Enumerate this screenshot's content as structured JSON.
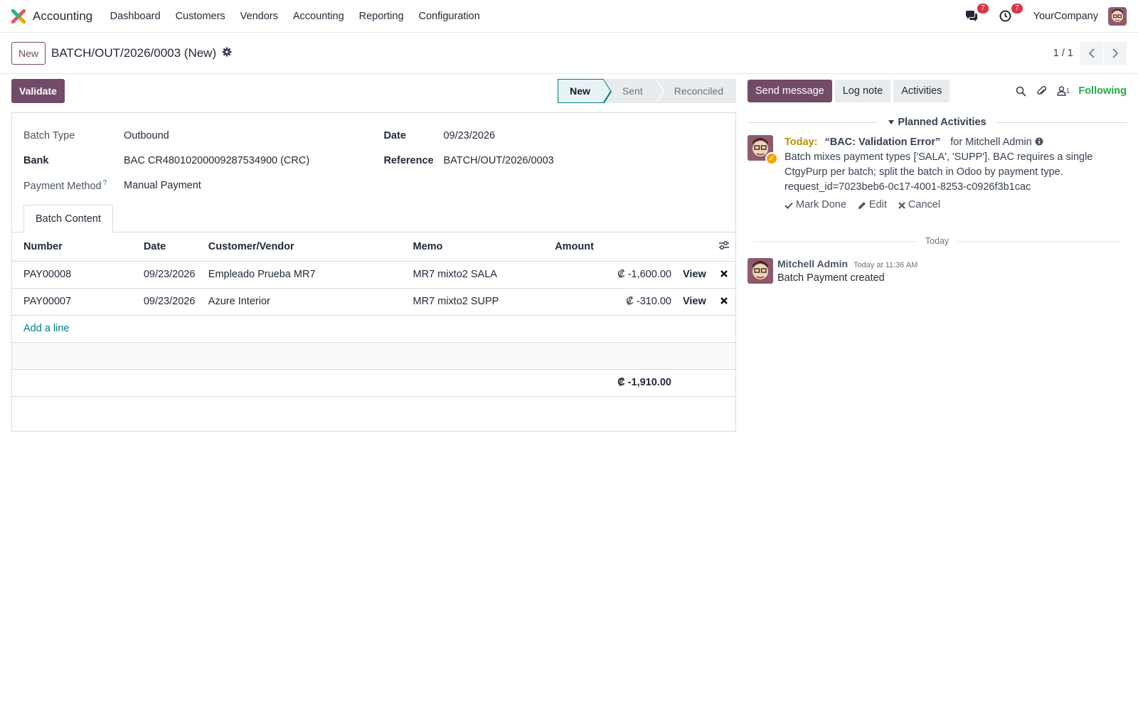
{
  "navbar": {
    "app_name": "Accounting",
    "menu": [
      "Dashboard",
      "Customers",
      "Vendors",
      "Accounting",
      "Reporting",
      "Configuration"
    ],
    "messages_badge": "7",
    "activities_badge": "7",
    "company": "YourCompany"
  },
  "control_panel": {
    "new_label": "New",
    "title": "BATCH/OUT/2026/0003 (New)",
    "pager": "1 / 1"
  },
  "form": {
    "validate_label": "Validate",
    "stages": [
      "New",
      "Sent",
      "Reconciled"
    ],
    "current_stage": "New",
    "fields": {
      "batch_type_label": "Batch Type",
      "batch_type": "Outbound",
      "bank_label": "Bank",
      "bank": "BAC CR48010200009287534900 (CRC)",
      "payment_method_label": "Payment Method",
      "payment_method_help": "?",
      "payment_method": "Manual Payment",
      "date_label": "Date",
      "date": "09/23/2026",
      "reference_label": "Reference",
      "reference": "BATCH/OUT/2026/0003"
    },
    "tab": "Batch Content",
    "table": {
      "headers": [
        "Number",
        "Date",
        "Customer/Vendor",
        "Memo",
        "Amount"
      ],
      "rows": [
        {
          "number": "PAY00008",
          "date": "09/23/2026",
          "partner": "Empleado Prueba MR7",
          "memo": "MR7 mixto2 SALA",
          "amount": "₡ -1,600.00",
          "view": "View"
        },
        {
          "number": "PAY00007",
          "date": "09/23/2026",
          "partner": "Azure Interior",
          "memo": "MR7 mixto2 SUPP",
          "amount": "₡ -310.00",
          "view": "View"
        }
      ],
      "add_line": "Add a line",
      "total": "₡ -1,910.00"
    }
  },
  "chatter": {
    "send_message": "Send message",
    "log_note": "Log note",
    "activities": "Activities",
    "followers_count": "1",
    "following": "Following",
    "planned_title": "Planned Activities",
    "activity": {
      "due": "Today:",
      "summary": "“BAC: Validation Error”",
      "for": "for Mitchell Admin",
      "note": "Batch mixes payment types ['SALA', 'SUPP']. BAC requires a single CtgyPurp per batch; split the batch in Odoo by payment type. request_id=7023beb6-0c17-4001-8253-c0926f3b1cac",
      "mark_done": "Mark Done",
      "edit": "Edit",
      "cancel": "Cancel"
    },
    "separator": "Today",
    "message": {
      "author": "Mitchell Admin",
      "date": "Today at 11:36 AM",
      "body": "Batch Payment created"
    }
  },
  "colors": {
    "brand": "#714b67",
    "link": "#017e84",
    "badge": "#dc3545",
    "following": "#28a745",
    "activity_today": "#c28c00"
  }
}
